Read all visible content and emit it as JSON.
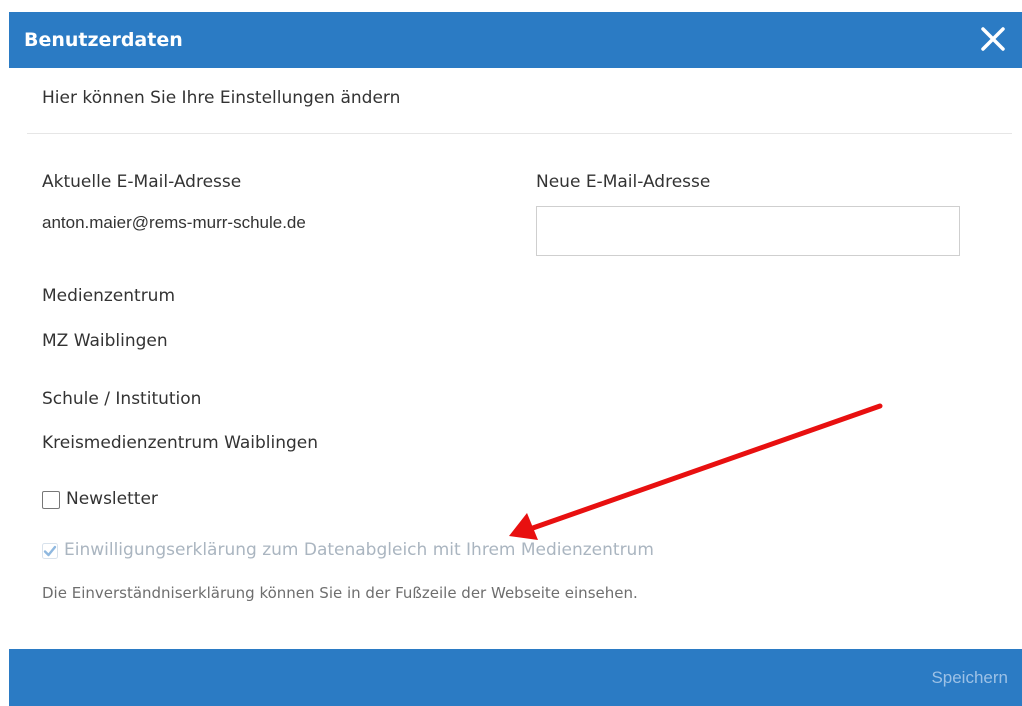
{
  "dialog": {
    "title": "Benutzerdaten",
    "close_icon": "close-icon",
    "intro": "Hier können Sie Ihre Einstellungen ändern"
  },
  "fields": {
    "current_email_label": "Aktuelle E-Mail-Adresse",
    "current_email_value": "anton.maier@rems-murr-schule.de",
    "new_email_label": "Neue E-Mail-Adresse",
    "new_email_value": "",
    "media_center_label": "Medienzentrum",
    "media_center_value": "MZ Waiblingen",
    "school_label": "Schule / Institution",
    "school_value": "Kreismedienzentrum Waiblingen"
  },
  "options": {
    "newsletter_label": "Newsletter",
    "newsletter_checked": false,
    "consent_label": "Einwilligungserklärung zum Datenabgleich mit Ihrem Medienzentrum",
    "consent_checked": true,
    "consent_disabled": true,
    "consent_note": "Die Einverständniserklärung können Sie in der Fußzeile der Webseite einsehen."
  },
  "footer": {
    "save_label": "Speichern"
  },
  "colors": {
    "header_bg": "#2b7bc4",
    "annotation_arrow": "#e81010",
    "disabled_text": "#aab5c0",
    "save_text": "#9cc1e6"
  }
}
